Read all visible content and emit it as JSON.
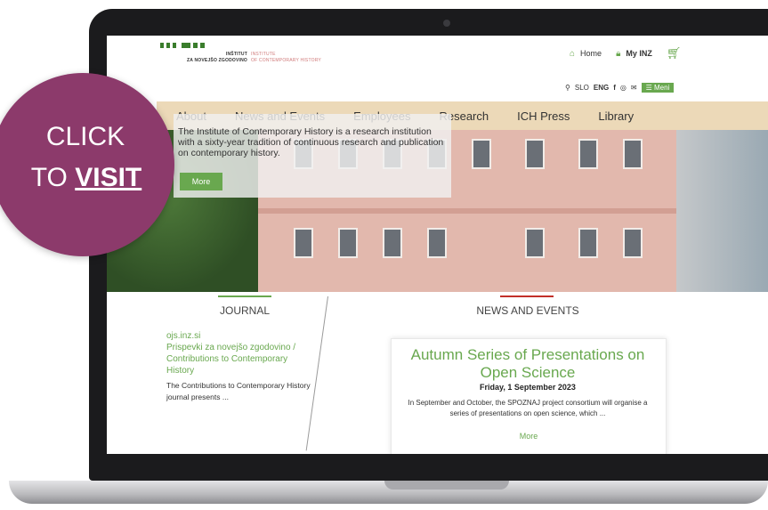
{
  "logo": {
    "sl_line1": "INŠTITUT",
    "sl_line2": "ZA NOVEJŠO ZGODOVINO",
    "en_line1": "INSTITUTE",
    "en_line2": "OF CONTEMPORARY HISTORY"
  },
  "toplinks": {
    "home": "Home",
    "home_icon": "home-icon",
    "my_inz": "My INZ",
    "lock_icon": "lock-icon",
    "basket_icon": "basket-icon"
  },
  "langbar": {
    "slo": "SLO",
    "eng": "ENG",
    "meni": "Meni",
    "search_icon": "search-icon",
    "facebook_icon": "facebook-icon",
    "instagram_icon": "instagram-icon",
    "email_icon": "email-icon"
  },
  "nav": {
    "items": [
      {
        "label": "About"
      },
      {
        "label": "News and Events"
      },
      {
        "label": "Employees"
      },
      {
        "label": "Research"
      },
      {
        "label": "ICH Press"
      },
      {
        "label": "Library"
      }
    ]
  },
  "hero": {
    "text": "The Institute of Contemporary History is a research institution with a sixty-year tradition of continuous research and publication on contemporary history.",
    "more": "More"
  },
  "journal": {
    "title": "JOURNAL",
    "link1": "ojs.inz.si",
    "link2": "Prispevki za novejšo zgodovino /",
    "link3": "Contributions to Contemporary",
    "link4": "History",
    "text": "The Contributions to Contemporary History journal presents ..."
  },
  "news": {
    "title": "NEWS AND EVENTS",
    "card_title": "Autumn Series of Presentations on Open Science",
    "card_date": "Friday, 1 September 2023",
    "card_text": "In September and October, the SPOZNAJ project consortium will organise a series of presentations on open science, which ...",
    "card_more": "More"
  },
  "badge": {
    "line1": "CLICK",
    "line2_prefix": "TO ",
    "line2_bold": "VISIT"
  },
  "colors": {
    "accent_green": "#69a84f",
    "nav_bg": "#ecd9b8",
    "badge": "#8c3a6b",
    "news_rule": "#c2302a"
  }
}
